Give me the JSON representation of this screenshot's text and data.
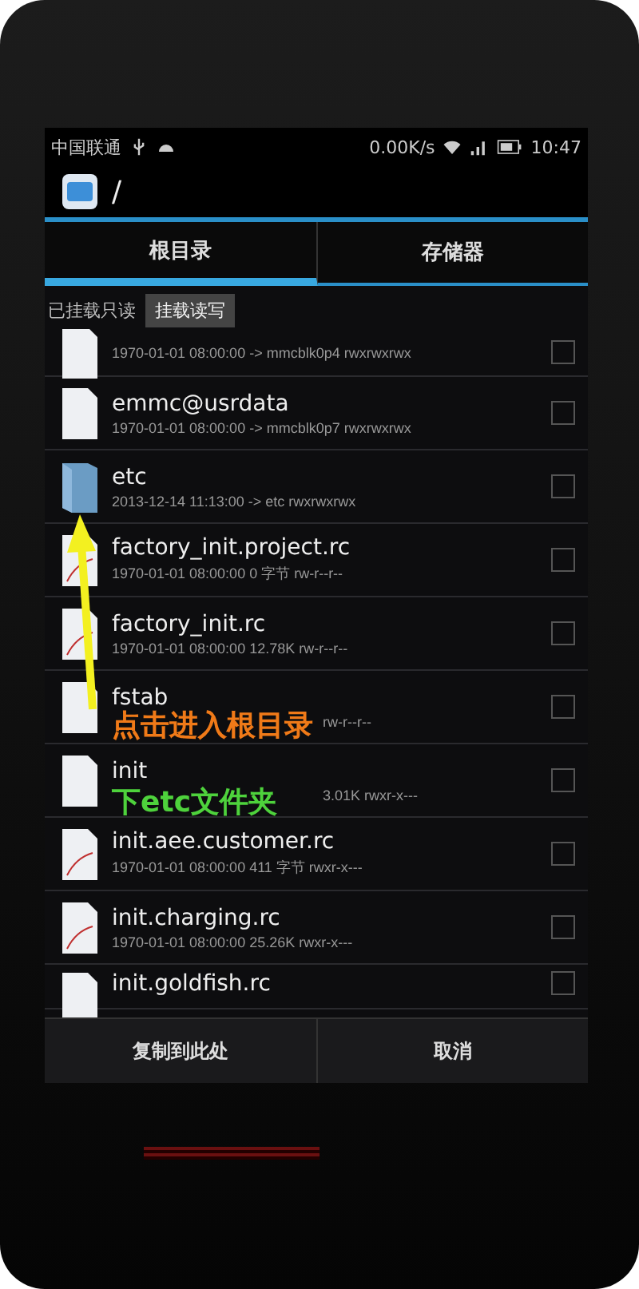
{
  "status_bar": {
    "carrier": "中国联通",
    "speed": "0.00K/s",
    "time": "10:47"
  },
  "action_bar": {
    "title": "/"
  },
  "tabs": [
    {
      "label": "根目录",
      "selected": true
    },
    {
      "label": "存储器",
      "selected": false
    }
  ],
  "mount": {
    "status": "已挂载只读",
    "button": "挂载读写"
  },
  "files": [
    {
      "kind": "file",
      "meta": "1970-01-01 08:00:00 -> mmcblk0p4 rwxrwxrwx",
      "checked": false,
      "meta_covered": false
    },
    {
      "kind": "file",
      "name": "emmc@usrdata",
      "meta": "1970-01-01 08:00:00 -> mmcblk0p7 rwxrwxrwx",
      "checked": false,
      "meta_covered": false
    },
    {
      "kind": "folder",
      "name": "etc",
      "meta": "2013-12-14 11:13:00 -> etc rwxrwxrwx",
      "checked": false,
      "meta_covered": false
    },
    {
      "kind": "script",
      "name": "factory_init.project.rc",
      "meta": "1970-01-01 08:00:00 0 字节 rw-r--r--",
      "checked": false,
      "meta_covered": false
    },
    {
      "kind": "script",
      "name": "factory_init.rc",
      "meta": "1970-01-01 08:00:00 12.78K rw-r--r--",
      "checked": false,
      "meta_covered": false
    },
    {
      "kind": "file",
      "name": "fstab",
      "meta": "rw-r--r--",
      "checked": false,
      "meta_covered": true
    },
    {
      "kind": "file",
      "name": "init",
      "meta": "3.01K rwxr-x---",
      "checked": false,
      "meta_covered": true
    },
    {
      "kind": "script",
      "name": "init.aee.customer.rc",
      "meta": "1970-01-01 08:00:00 411 字节 rwxr-x---",
      "checked": false,
      "meta_covered": false
    },
    {
      "kind": "script",
      "name": "init.charging.rc",
      "meta": "1970-01-01 08:00:00 25.26K rwxr-x---",
      "checked": false,
      "meta_covered": false
    },
    {
      "kind": "file",
      "name": "init.goldfish.rc",
      "checked": false
    }
  ],
  "bottom_buttons": [
    "复制到此处",
    "取消"
  ],
  "annotation": {
    "lines": [
      "点击进入根目录",
      "下etc文件夹"
    ]
  }
}
